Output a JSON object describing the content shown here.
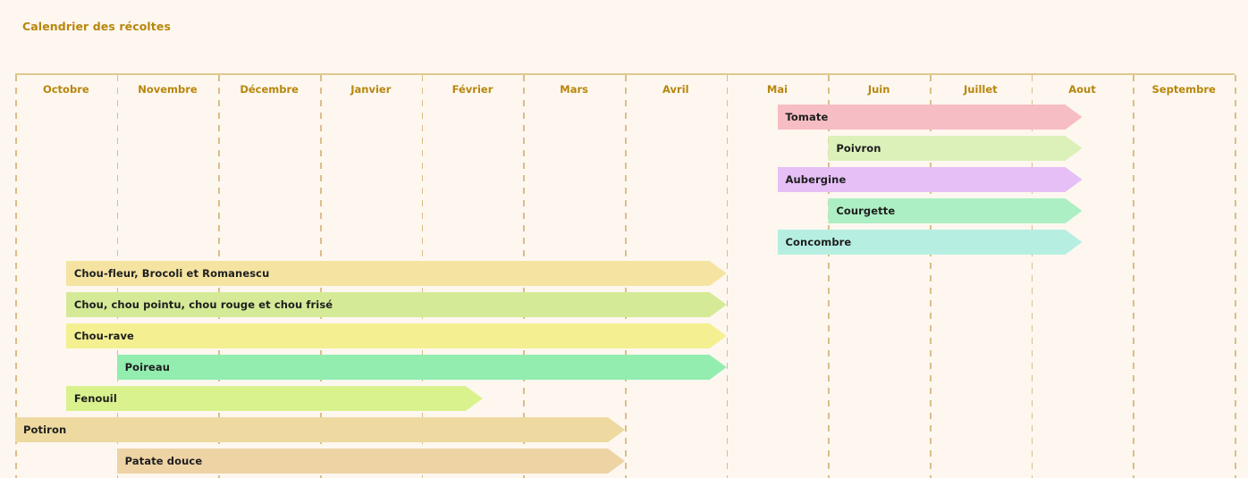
{
  "chart_title": "Calendrier des récoltes",
  "title_color": "#B8860B",
  "background_color": "#FDF7F0",
  "axis": {
    "months": [
      "Octobre",
      "Novembre",
      "Décembre",
      "Janvier",
      "Février",
      "Mars",
      "Avril",
      "Mai",
      "Juin",
      "Juillet",
      "Aout",
      "Septembre"
    ]
  },
  "chart_data": {
    "type": "bar",
    "orientation": "horizontal",
    "title": "Calendrier des récoltes",
    "xlabel": "",
    "ylabel": "",
    "categories": [
      "Octobre",
      "Novembre",
      "Décembre",
      "Janvier",
      "Février",
      "Mars",
      "Avril",
      "Mai",
      "Juin",
      "Juillet",
      "Aout",
      "Septembre"
    ],
    "grid": true,
    "legend": "none",
    "note": "Each task is a horizontal arrow bar spanning a range of months. start/end are fractional month indices where 0 = left edge of Octobre and 12 = right edge of Septembre.",
    "tasks": [
      {
        "label": "Tomate",
        "start": 7.5,
        "end": 10.5,
        "color": "#F7BDC4"
      },
      {
        "label": "Poivron",
        "start": 8.0,
        "end": 10.5,
        "color": "#DCF0B9"
      },
      {
        "label": "Aubergine",
        "start": 7.5,
        "end": 10.5,
        "color": "#E5BFF5"
      },
      {
        "label": "Courgette",
        "start": 8.0,
        "end": 10.5,
        "color": "#ADEFC4"
      },
      {
        "label": "Concombre",
        "start": 7.5,
        "end": 10.5,
        "color": "#B6EFE1"
      },
      {
        "label": "Chou-fleur, Brocoli et Romanescu",
        "start": 0.5,
        "end": 7.0,
        "color": "#F5E3A2"
      },
      {
        "label": "Chou, chou pointu, chou rouge et chou frisé",
        "start": 0.5,
        "end": 7.0,
        "color": "#D4EA96"
      },
      {
        "label": "Chou-rave",
        "start": 0.5,
        "end": 7.0,
        "color": "#F4F091"
      },
      {
        "label": "Poireau",
        "start": 1.0,
        "end": 7.0,
        "color": "#92EDAF"
      },
      {
        "label": "Fenouil",
        "start": 0.5,
        "end": 4.6,
        "color": "#DAF28E"
      },
      {
        "label": "Potiron",
        "start": 0.0,
        "end": 6.0,
        "color": "#EEDAA0"
      },
      {
        "label": "Patate douce",
        "start": 1.0,
        "end": 6.0,
        "color": "#EED3A5"
      }
    ]
  }
}
